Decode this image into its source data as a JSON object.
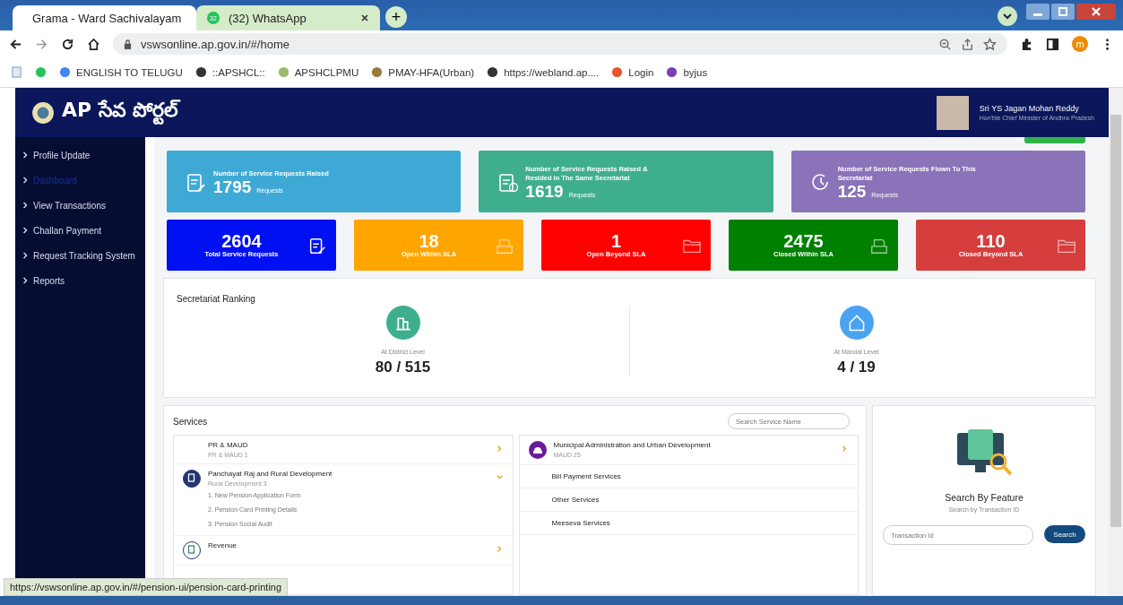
{
  "browser": {
    "tabs": [
      {
        "title": "Grama - Ward Sachivalayam",
        "selected": true
      },
      {
        "title": "(32) WhatsApp",
        "selected": false,
        "badge": "32"
      }
    ],
    "new_tab": "+",
    "address": "vswsonline.ap.gov.in/#/home",
    "profile_initial": "m",
    "bookmarks": [
      "ENGLISH TO TELUGU",
      "::APSHCL::",
      "APSHCLPMU",
      "PMAY-HFA(Urban)",
      "https://webland.ap....",
      "Login",
      "byjus"
    ]
  },
  "header": {
    "logo_text": "AP సేవ పోర్టల్",
    "user_name": "Sri YS Jagan Mohan Reddy",
    "user_role": "Hon'ble Chief Minister of Andhra Pradesh"
  },
  "sidebar": {
    "items": [
      {
        "label": "Profile Update",
        "selected": false
      },
      {
        "label": "Dashboard",
        "selected": true
      },
      {
        "label": "View Transactions",
        "selected": false
      },
      {
        "label": "Challan Payment",
        "selected": false
      },
      {
        "label": "Request Tracking System",
        "selected": false
      },
      {
        "label": "Reports",
        "selected": false
      }
    ]
  },
  "summary_cards": [
    {
      "title": "Number of Service Requests Raised",
      "count": "1795",
      "unit": "Requests",
      "color": "#3fa9d5",
      "kind": "raised"
    },
    {
      "title": "Number of Service Requests Raised & Resided In The Same Secretariat",
      "count": "1619",
      "unit": "Requests",
      "color": "#3fae8e",
      "kind": "resided"
    },
    {
      "title": "Number of Service Requests Flown To This Secretariat",
      "count": "125",
      "unit": "Requests",
      "color": "#8a73b9",
      "kind": "flown"
    }
  ],
  "status_cards": [
    {
      "count": "2604",
      "label": "Total Service Requests",
      "color": "#0010f2",
      "kind": "clipboard"
    },
    {
      "count": "18",
      "label": "Open Within SLA",
      "color": "#ffa500",
      "kind": "tray"
    },
    {
      "count": "1",
      "label": "Open Beyond SLA",
      "color": "#ff0000",
      "kind": "folder"
    },
    {
      "count": "2475",
      "label": "Closed Within SLA",
      "color": "#008000",
      "kind": "tray"
    },
    {
      "count": "110",
      "label": "Closed Beyond SLA",
      "color": "#d63d3d",
      "kind": "folder"
    }
  ],
  "ranking": {
    "title": "Secretariat Ranking",
    "levels": [
      {
        "label": "At District Level",
        "value": "80 / 515",
        "color": "#3fae8e",
        "kind": "building"
      },
      {
        "label": "At Mandal Level",
        "value": "4 / 19",
        "color": "#4aa3f0",
        "kind": "house"
      }
    ]
  },
  "services": {
    "title": "Services",
    "search_placeholder": "Search Service Name",
    "left": [
      {
        "title": "PR & MAUD",
        "subtitle": "PR & MAUD 1",
        "expanded": false,
        "icon": false
      },
      {
        "title": "Panchayat Raj and Rural Development",
        "subtitle": "Rural Development 3",
        "expanded": true,
        "icon": true,
        "items": [
          "1. New Pension Application Form",
          "2. Pension Card Printing Details",
          "3. Pension Social Audit"
        ]
      },
      {
        "title": "Revenue",
        "expanded": false,
        "icon": true
      }
    ],
    "right": [
      {
        "kind": "category",
        "title": "Municipal Administration and Urban Development",
        "subtitle": "MAUD 25"
      },
      {
        "kind": "link",
        "title": "Bill Payment Services"
      },
      {
        "kind": "link",
        "title": "Other Services"
      },
      {
        "kind": "link",
        "title": "Meeseva Services"
      }
    ]
  },
  "search_feature": {
    "title": "Search By Feature",
    "subtitle": "Search by Transaction ID",
    "placeholder": "Transaction Id",
    "button": "Search"
  },
  "status_url": "https://vswsonline.ap.gov.in/#/pension-ui/pension-card-printing"
}
